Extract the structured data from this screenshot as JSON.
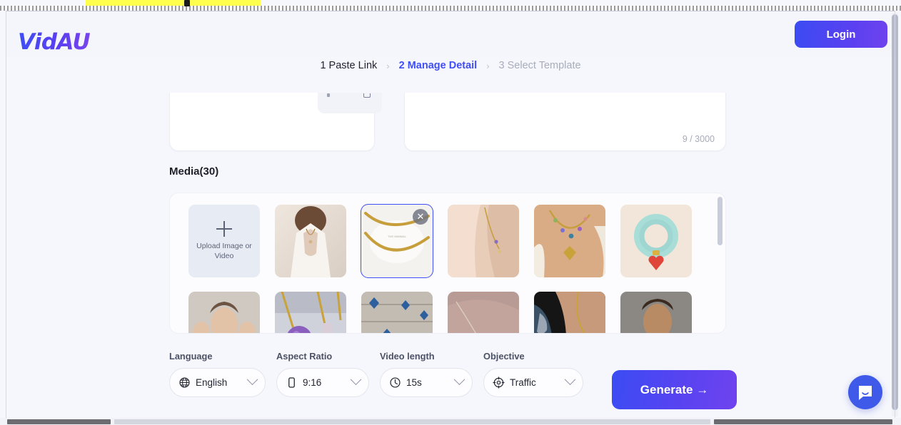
{
  "brand": {
    "logo_text": "VidAU"
  },
  "header": {
    "login_label": "Login"
  },
  "breadcrumb": {
    "steps": [
      {
        "label": "1 Paste Link",
        "state": "done"
      },
      {
        "label": "2 Manage Detail",
        "state": "active"
      },
      {
        "label": "3 Select Template",
        "state": "future"
      }
    ],
    "separator": "›"
  },
  "editor": {
    "char_counter": "9 / 3000"
  },
  "media": {
    "label": "Media(30)",
    "upload": {
      "icon": "plus-icon",
      "label": "Upload Image or Video"
    },
    "close_icon": "close-icon",
    "items": [
      {
        "alt": "woman in white dress wearing gold lariat necklace",
        "selected": false
      },
      {
        "alt": "gold beaded chain necklace on white marble dish",
        "selected": true
      },
      {
        "alt": "gold initial charm necklace on neck",
        "selected": false
      },
      {
        "alt": "layered colorful charm necklace with gold heart pendant",
        "selected": false
      },
      {
        "alt": "mint green beaded bracelet with red heart charm",
        "selected": false
      },
      {
        "alt": "model reclining with hands near face",
        "selected": false
      },
      {
        "alt": "amethyst crystal pendant necklaces on stone",
        "selected": false
      },
      {
        "alt": "blue star confetti on weathered wood",
        "selected": false
      },
      {
        "alt": "thin gold chain necklace on mauve fabric",
        "selected": false
      },
      {
        "alt": "neck with gold chain and patterned garment",
        "selected": false
      },
      {
        "alt": "portrait of woman on gray background",
        "selected": false
      }
    ]
  },
  "controls": [
    {
      "label": "Language",
      "value": "English",
      "icon": "globe-icon"
    },
    {
      "label": "Aspect Ratio",
      "value": "9:16",
      "icon": "phone-icon"
    },
    {
      "label": "Video length",
      "value": "15s",
      "icon": "clock-icon"
    },
    {
      "label": "Objective",
      "value": "Traffic",
      "icon": "target-icon"
    }
  ],
  "generate": {
    "label": "Generate",
    "arrow": "→"
  },
  "chat": {
    "icon": "chat-bubble-icon"
  },
  "colors": {
    "accent_blue": "#3f4ef6",
    "accent_purple": "#6f43ee",
    "page_bg": "#f6f7fc",
    "muted_text": "#a9acbb"
  }
}
